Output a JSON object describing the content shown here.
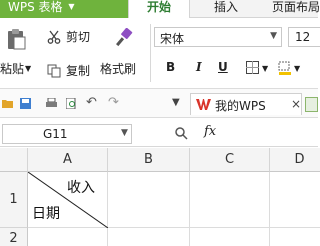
{
  "titlebar": {
    "app_name": "WPS 表格",
    "tabs": [
      "开始",
      "插入",
      "页面布局"
    ]
  },
  "toolbar": {
    "paste_label": "粘贴",
    "cut_label": "剪切",
    "copy_label": "复制",
    "format_painter_label": "格式刷",
    "font_name": "宋体",
    "font_size": "12",
    "bold_label": "B",
    "italic_label": "I",
    "underline_label": "U"
  },
  "quick_access": {
    "doc_tab_label": "我的WPS",
    "close_glyph": "×"
  },
  "formula_bar": {
    "cell_ref": "G11",
    "fx_label": "fx"
  },
  "sheet": {
    "column_headers": [
      "A",
      "B",
      "C",
      "D"
    ],
    "row_headers": [
      "1",
      "2"
    ],
    "cell_A1_top_right": "收入",
    "cell_A1_bottom_left": "日期"
  },
  "colors": {
    "app_tab_bg": "#6fb33d",
    "active_tab_text": "#2e7d32",
    "doc_tab_icon": "#d9342b"
  },
  "icons": [
    "paste-icon",
    "cut-icon",
    "copy-icon",
    "format-painter-icon",
    "border-icon",
    "fill-color-icon",
    "open-folder-icon",
    "save-icon",
    "print-icon",
    "print-preview-icon",
    "undo-icon",
    "redo-icon",
    "wps-logo-icon",
    "zoom-icon"
  ]
}
